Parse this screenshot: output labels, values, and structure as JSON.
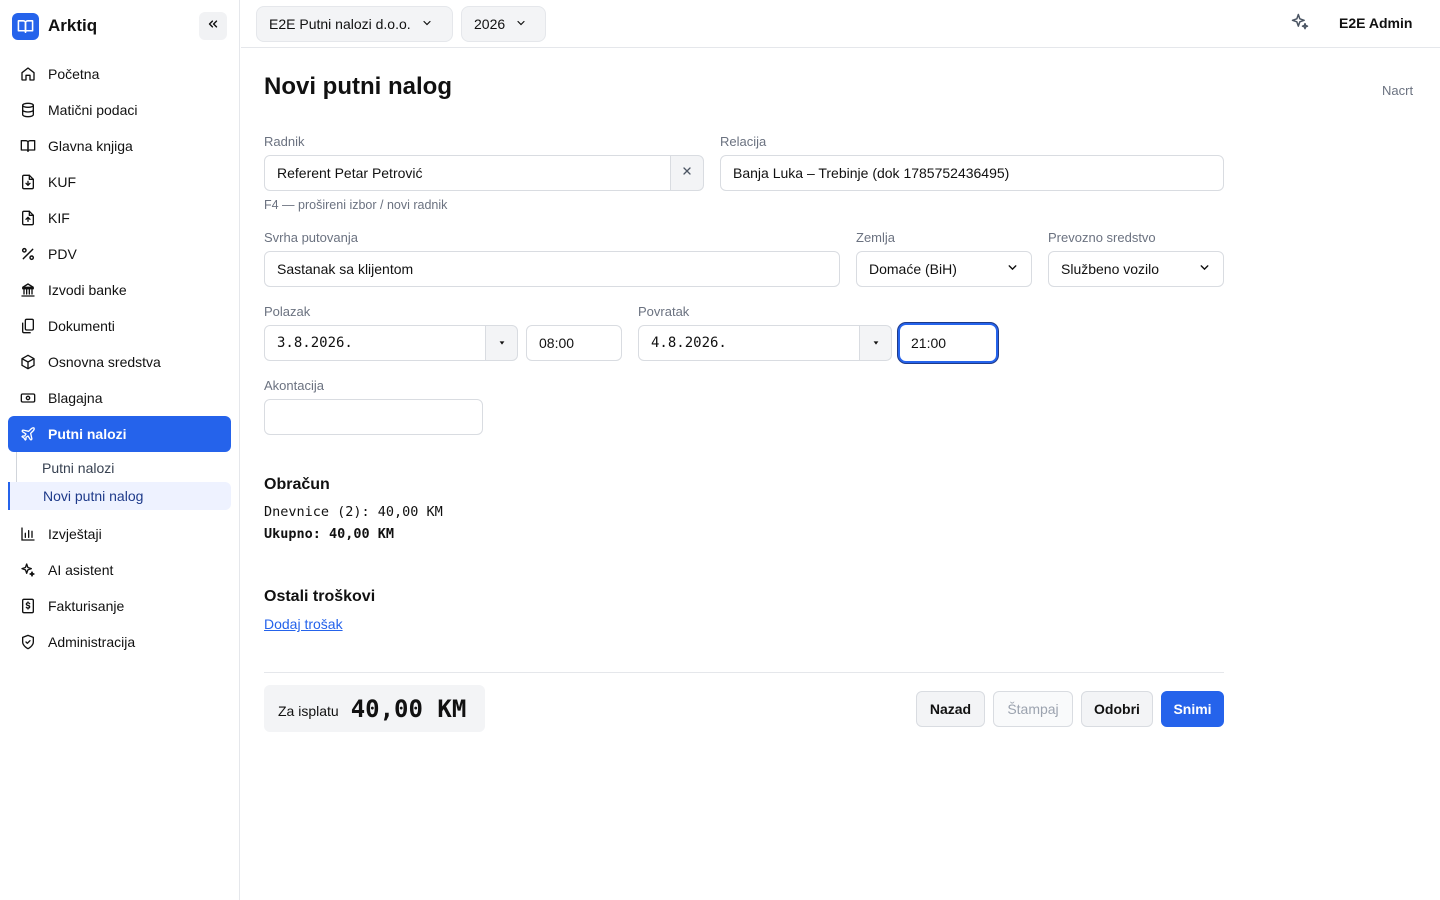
{
  "app": {
    "name": "Arktiq"
  },
  "sidebar": {
    "items": [
      {
        "label": "Početna",
        "icon": "home-icon"
      },
      {
        "label": "Matični podaci",
        "icon": "database-icon"
      },
      {
        "label": "Glavna knjiga",
        "icon": "book-icon"
      },
      {
        "label": "KUF",
        "icon": "file-in-icon"
      },
      {
        "label": "KIF",
        "icon": "file-out-icon"
      },
      {
        "label": "PDV",
        "icon": "percent-icon"
      },
      {
        "label": "Izvodi banke",
        "icon": "bank-icon"
      },
      {
        "label": "Dokumenti",
        "icon": "documents-icon"
      },
      {
        "label": "Osnovna sredstva",
        "icon": "box-icon"
      },
      {
        "label": "Blagajna",
        "icon": "cash-icon"
      },
      {
        "label": "Putni nalozi",
        "icon": "plane-icon",
        "active": true
      },
      {
        "label": "Izvještaji",
        "icon": "bar-chart-icon"
      },
      {
        "label": "AI asistent",
        "icon": "sparkles-icon"
      },
      {
        "label": "Fakturisanje",
        "icon": "invoice-icon"
      },
      {
        "label": "Administracija",
        "icon": "shield-icon"
      }
    ],
    "subitems": [
      {
        "label": "Putni nalozi"
      },
      {
        "label": "Novi putni nalog",
        "active": true
      }
    ]
  },
  "topbar": {
    "company": "E2E Putni nalozi d.o.o.",
    "year": "2026",
    "user": "E2E Admin"
  },
  "page": {
    "title": "Novi putni nalog",
    "status": "Nacrt"
  },
  "form": {
    "radnik": {
      "label": "Radnik",
      "value": "Referent Petar Petrović",
      "hint": "F4 — prošireni izbor / novi radnik"
    },
    "relacija": {
      "label": "Relacija",
      "value": "Banja Luka – Trebinje (dok 1785752436495)"
    },
    "svrha": {
      "label": "Svrha putovanja",
      "value": "Sastanak sa klijentom"
    },
    "zemlja": {
      "label": "Zemlja",
      "value": "Domaće (BiH)"
    },
    "prevozno": {
      "label": "Prevozno sredstvo",
      "value": "Službeno vozilo"
    },
    "polazak": {
      "label": "Polazak",
      "date": "3.8.2026.",
      "time": "08:00"
    },
    "povratak": {
      "label": "Povratak",
      "date": "4.8.2026.",
      "time": "21:00"
    },
    "akontacija": {
      "label": "Akontacija",
      "value": ""
    }
  },
  "obracun": {
    "title": "Obračun",
    "dnevnice": "Dnevnice (2): 40,00 KM",
    "ukupno": "Ukupno: 40,00 KM"
  },
  "ostali": {
    "title": "Ostali troškovi",
    "add_link": "Dodaj trošak"
  },
  "footer": {
    "total_label": "Za isplatu",
    "total_value": "40,00 KM",
    "buttons": {
      "nazad": "Nazad",
      "stampaj": "Štampaj",
      "odobri": "Odobri",
      "snimi": "Snimi"
    }
  },
  "colors": {
    "accent": "#2563eb",
    "muted": "#6b7280",
    "border": "#d9dce1"
  }
}
